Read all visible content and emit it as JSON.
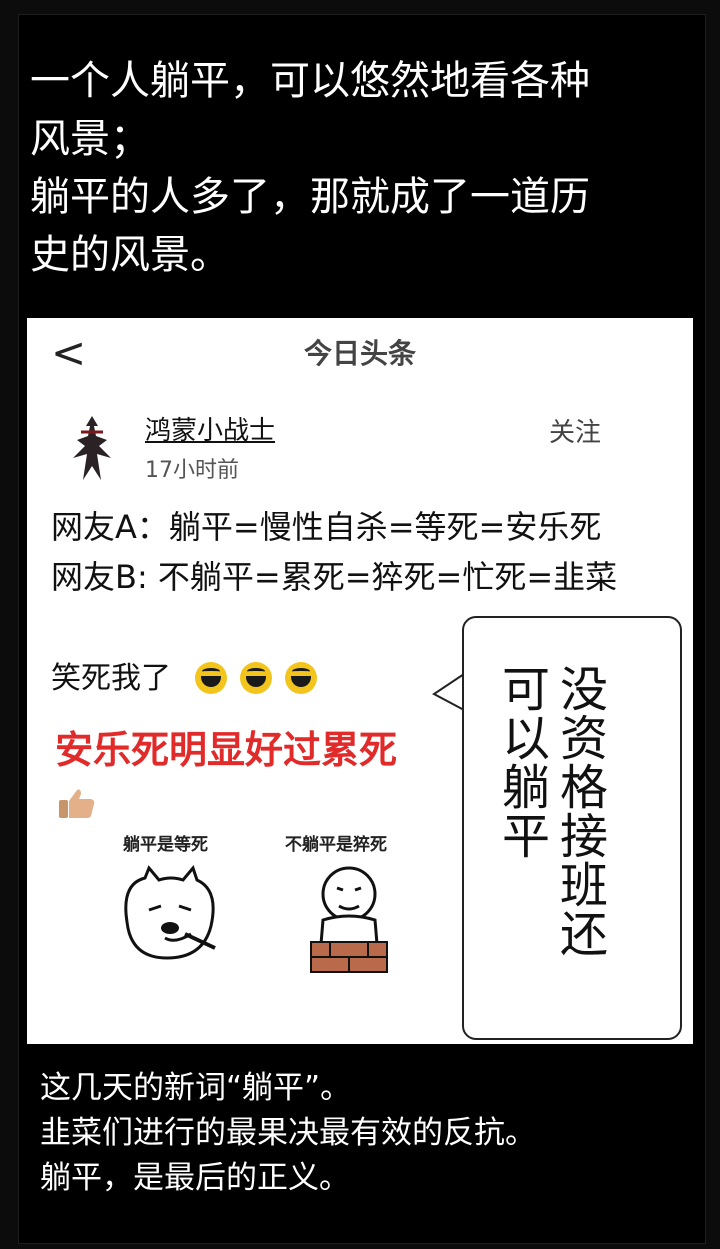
{
  "top_caption": {
    "line1": "一个人躺平，可以悠然地看各种",
    "line2": "风景；",
    "line3": "躺平的人多了，那就成了一道历",
    "line4": "史的风景。"
  },
  "post": {
    "nav_back": "<",
    "nav_title": "今日头条",
    "username": "鸿蒙小战士",
    "timestamp": "17小时前",
    "follow_label": "关注",
    "line_a": "网友A：躺平=慢性自杀=等死=安乐死",
    "line_b": "网友B: 不躺平=累死=猝死=忙死=韭菜",
    "laugh_text": "笑死我了",
    "highlight": "安乐死明显好过累死",
    "meme_left_label": "躺平是等死",
    "meme_right_label": "不躺平是猝死"
  },
  "bubble": {
    "text": "没资格接班还可以躺平"
  },
  "bottom_caption": {
    "line1": "这几天的新词“躺平”。",
    "line2": "韭菜们进行的最果决最有效的反抗。",
    "line3": "躺平，是最后的正义。"
  },
  "colors": {
    "background": "#000000",
    "caption_text": "#ffffff",
    "highlight_red": "#e12b2b",
    "emoji_yellow": "#f3c41c"
  },
  "icons": [
    "back-arrow-icon",
    "avatar-warrior-icon",
    "laughing-emoji-icon",
    "thumbs-up-icon"
  ]
}
